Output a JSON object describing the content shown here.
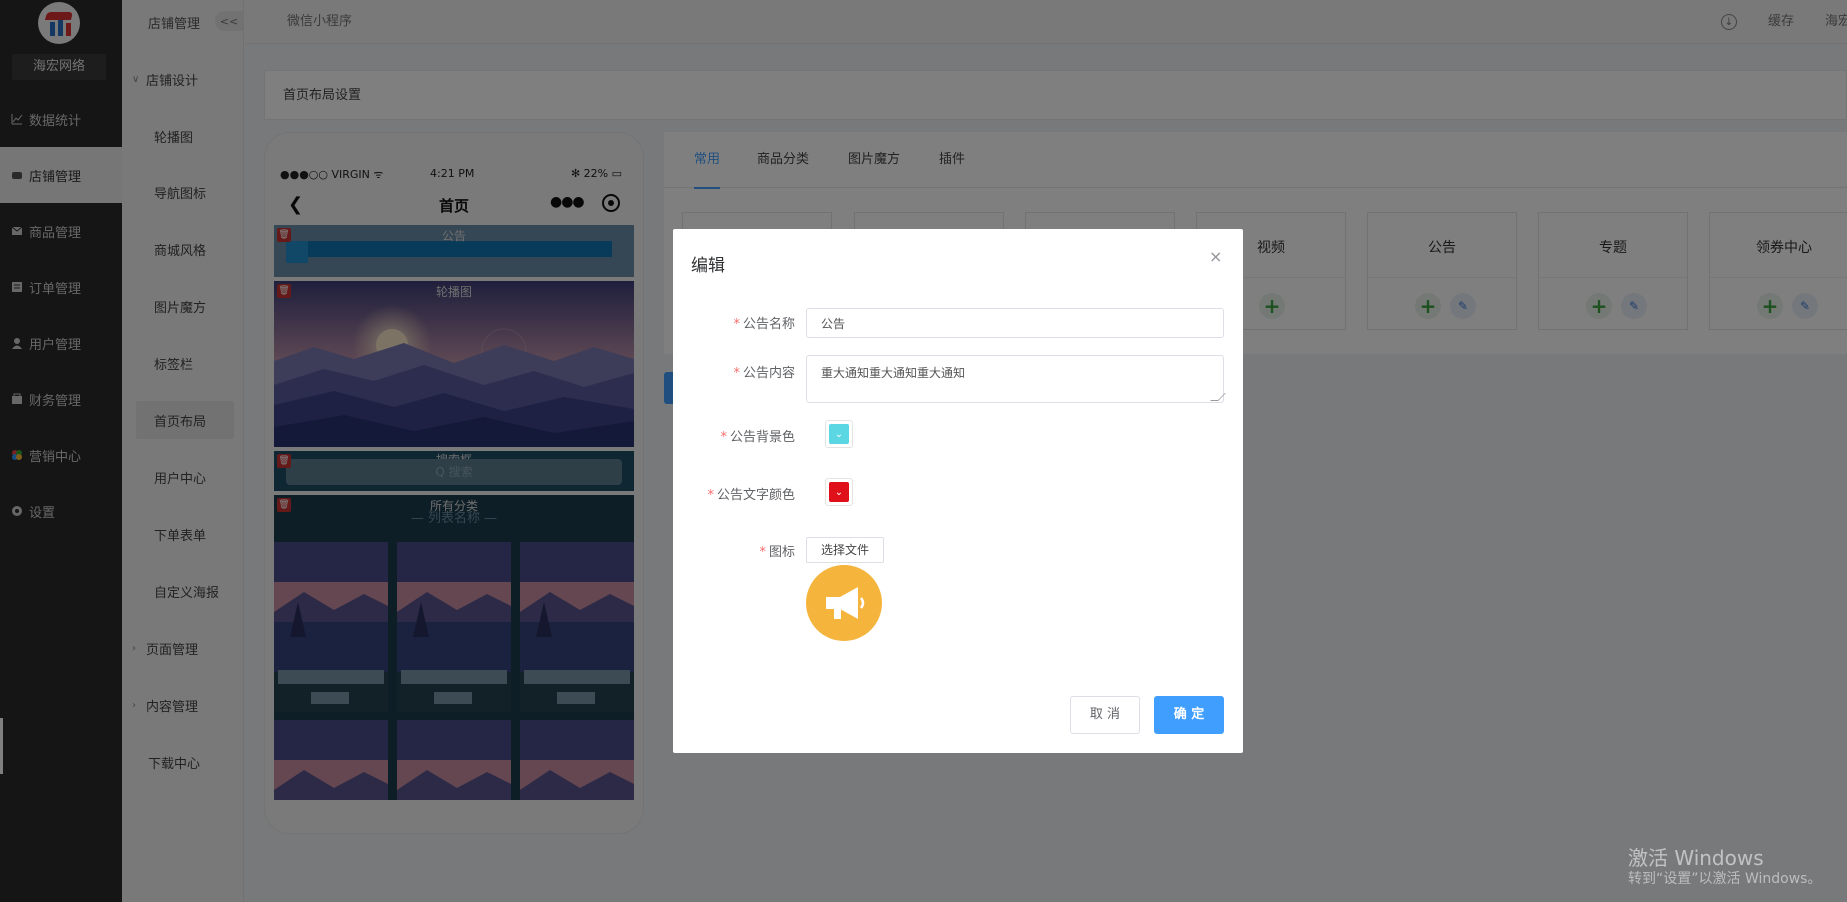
{
  "brand": "海宏网络",
  "sidebar_main": [
    {
      "label": "数据统计",
      "icon": "chart-icon"
    },
    {
      "label": "店铺管理",
      "icon": "store-icon",
      "active": true
    },
    {
      "label": "商品管理",
      "icon": "product-icon"
    },
    {
      "label": "订单管理",
      "icon": "order-icon"
    },
    {
      "label": "用户管理",
      "icon": "user-icon"
    },
    {
      "label": "财务管理",
      "icon": "finance-icon"
    },
    {
      "label": "营销中心",
      "icon": "marketing-icon"
    },
    {
      "label": "设置",
      "icon": "settings-icon"
    }
  ],
  "sidebar_sub": {
    "header": "店铺管理",
    "collapse": "<<",
    "group1": "店铺设计",
    "items": [
      "轮播图",
      "导航图标",
      "商城风格",
      "图片魔方",
      "标签栏",
      "首页布局",
      "用户中心",
      "下单表单",
      "自定义海报"
    ],
    "group2": "页面管理",
    "group3": "内容管理",
    "download": "下载中心"
  },
  "topbar": {
    "breadcrumb": "微信小程序",
    "cache": "缓存",
    "user": "海宏"
  },
  "page_title": "首页布局设置",
  "phone": {
    "carrier": "●●●○○ VIRGIN ᯤ",
    "time": "4:21 PM",
    "battery": "✻ 22% ▭",
    "nav_title": "首页",
    "notice_label": "公告",
    "banner_label": "轮播图",
    "search_label": "搜索框",
    "search_placeholder": "Q 搜索",
    "category_label": "所有分类",
    "list_name": "— 列表名称 —"
  },
  "tabs": [
    "常用",
    "商品分类",
    "图片魔方",
    "插件"
  ],
  "components": [
    {
      "name": "视频"
    },
    {
      "name": "公告"
    },
    {
      "name": "专题"
    },
    {
      "name": "领券中心"
    }
  ],
  "modal": {
    "title": "编辑",
    "close": "×",
    "name_label": "公告名称",
    "name_value": "公告",
    "content_label": "公告内容",
    "content_value": "重大通知重大通知重大通知",
    "bg_label": "公告背景色",
    "bg_color": "#5bd7e3",
    "text_color_label": "公告文字颜色",
    "text_color": "#e0101a",
    "icon_label": "图标",
    "file_button": "选择文件",
    "cancel": "取 消",
    "ok": "确 定"
  },
  "watermark": {
    "line1": "激活 Windows",
    "line2": "转到“设置”以激活 Windows。"
  }
}
